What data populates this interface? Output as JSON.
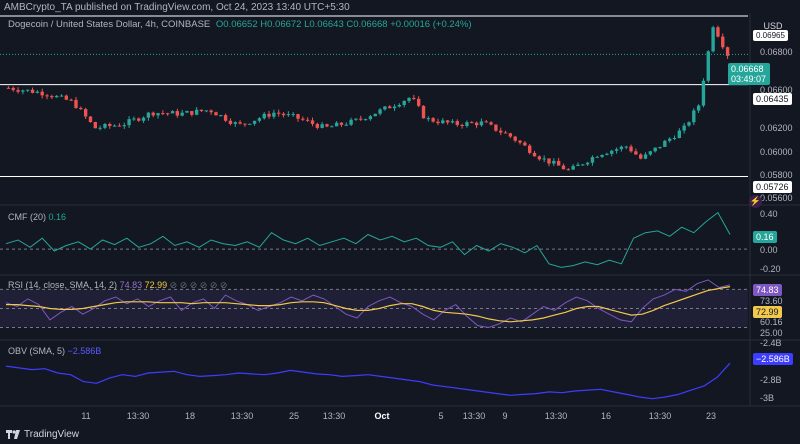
{
  "header": {
    "publisher": "AMBCrypto_TA published on TradingView.com, Oct 24, 2023 13:40 UTC+5:30",
    "symbol": "Dogecoin / United States Dollar, 4h, COINBASE",
    "ohlc": "O0.06652 H0.06672 L0.06643 C0.06668 +0.00016 (+0.24%)",
    "currency": "USD"
  },
  "labels": {
    "cmf": "CMF (20)",
    "cmf_value": "0.16",
    "rsi": "RSI (14, close, SMA, 14, 2)",
    "rsi_value": "74.83",
    "rsi_ma_value": "72.99",
    "rsi_dots": "⊘ ⊘ ⊘ ⊘ ⊘ ⊘",
    "obv": "OBV (SMA, 5)",
    "obv_value": "−2.586B",
    "brand": "TradingView"
  },
  "price_tags": {
    "current": "0.06668",
    "countdown": "03:49:07",
    "resistance": "0.06435",
    "support": "0.05726",
    "top_cut": "0.06965"
  },
  "colors": {
    "background": "#131722",
    "up": "#26a69a",
    "down": "#ef5350",
    "cmf": "#26a69a",
    "rsi": "#7e57c2",
    "rsi_ma": "#f2c94c",
    "obv": "#3d3dff",
    "level_line": "#ffffff"
  },
  "chart_data": [
    {
      "type": "candlestick",
      "title": "Dogecoin / United States Dollar, 4h, COINBASE",
      "y_ticks": [
        "0.06800",
        "0.06600",
        "0.06400",
        "0.06200",
        "0.06000",
        "0.05800",
        "0.05600"
      ],
      "ylim": [
        0.0556,
        0.0698
      ],
      "horizontal_levels": [
        0.06435,
        0.05726,
        0.06965
      ],
      "x_ticks": [
        "11",
        "13:30",
        "18",
        "13:30",
        "25",
        "13:30",
        "Oct",
        "5",
        "13:30",
        "9",
        "13:30",
        "16",
        "13:30",
        "23"
      ],
      "close_path_estimate": [
        {
          "x": 0.0,
          "close": 0.0641
        },
        {
          "x": 0.05,
          "close": 0.0637
        },
        {
          "x": 0.09,
          "close": 0.063
        },
        {
          "x": 0.12,
          "close": 0.061
        },
        {
          "x": 0.16,
          "close": 0.0613
        },
        {
          "x": 0.2,
          "close": 0.0622
        },
        {
          "x": 0.24,
          "close": 0.0621
        },
        {
          "x": 0.28,
          "close": 0.0624
        },
        {
          "x": 0.32,
          "close": 0.0612
        },
        {
          "x": 0.37,
          "close": 0.0622
        },
        {
          "x": 0.4,
          "close": 0.0618
        },
        {
          "x": 0.44,
          "close": 0.061
        },
        {
          "x": 0.48,
          "close": 0.0615
        },
        {
          "x": 0.52,
          "close": 0.0624
        },
        {
          "x": 0.56,
          "close": 0.0634
        },
        {
          "x": 0.58,
          "close": 0.0617
        },
        {
          "x": 0.62,
          "close": 0.0613
        },
        {
          "x": 0.66,
          "close": 0.0614
        },
        {
          "x": 0.7,
          "close": 0.0603
        },
        {
          "x": 0.74,
          "close": 0.0587
        },
        {
          "x": 0.78,
          "close": 0.0577
        },
        {
          "x": 0.82,
          "close": 0.059
        },
        {
          "x": 0.86,
          "close": 0.0596
        },
        {
          "x": 0.88,
          "close": 0.0586
        },
        {
          "x": 0.91,
          "close": 0.0598
        },
        {
          "x": 0.94,
          "close": 0.061
        },
        {
          "x": 0.96,
          "close": 0.0628
        },
        {
          "x": 0.98,
          "close": 0.069
        },
        {
          "x": 1.0,
          "close": 0.06668
        }
      ]
    },
    {
      "type": "line",
      "title": "CMF (20)",
      "y_ticks": [
        "0.40",
        "0.20",
        "0.00",
        "-0.20"
      ],
      "ylim": [
        -0.25,
        0.45
      ],
      "series": [
        {
          "name": "CMF",
          "values": [
            0.06,
            0.1,
            0.02,
            0.12,
            -0.02,
            0.04,
            0.08,
            0.0,
            0.1,
            0.05,
            0.12,
            0.02,
            0.06,
            0.14,
            0.04,
            0.08,
            0.02,
            0.1,
            0.06,
            0.04,
            0.08,
            0.02,
            0.18,
            0.1,
            0.06,
            0.12,
            0.04,
            0.08,
            0.12,
            0.06,
            0.16,
            0.1,
            0.14,
            0.08,
            0.12,
            0.04,
            0.02,
            0.08,
            -0.06,
            0.04,
            -0.02,
            0.06,
            0.02,
            -0.04,
            0.04,
            -0.16,
            -0.2,
            -0.18,
            -0.14,
            -0.17,
            -0.12,
            -0.16,
            0.12,
            0.18,
            0.2,
            0.14,
            0.24,
            0.18,
            0.3,
            0.4,
            0.16
          ]
        }
      ]
    },
    {
      "type": "line",
      "title": "RSI (14, close, SMA, 14, 2)",
      "y_ticks": [
        "73.60",
        "60.16",
        "25.00"
      ],
      "ylim": [
        20,
        82
      ],
      "series": [
        {
          "name": "RSI",
          "values": [
            56,
            52,
            60,
            54,
            38,
            46,
            52,
            44,
            50,
            58,
            62,
            55,
            60,
            52,
            58,
            62,
            48,
            56,
            60,
            50,
            64,
            58,
            54,
            48,
            52,
            56,
            62,
            58,
            64,
            60,
            52,
            44,
            40,
            52,
            58,
            62,
            56,
            52,
            44,
            38,
            48,
            54,
            42,
            32,
            30,
            34,
            40,
            36,
            44,
            52,
            48,
            56,
            62,
            58,
            50,
            44,
            38,
            36,
            50,
            60,
            64,
            70,
            68,
            76,
            80,
            72,
            74.83
          ]
        },
        {
          "name": "RSI-based MA",
          "values": [
            54,
            54,
            53,
            52,
            50,
            49,
            49,
            50,
            52,
            54,
            56,
            57,
            57,
            57,
            56,
            56,
            56,
            55,
            56,
            56,
            56,
            55,
            54,
            53,
            53,
            54,
            56,
            57,
            57,
            56,
            53,
            50,
            48,
            48,
            50,
            53,
            55,
            55,
            52,
            48,
            46,
            45,
            44,
            42,
            39,
            37,
            36,
            37,
            38,
            40,
            43,
            46,
            50,
            52,
            52,
            49,
            46,
            43,
            44,
            48,
            53,
            57,
            61,
            65,
            69,
            71,
            72.99
          ]
        }
      ]
    },
    {
      "type": "line",
      "title": "OBV (SMA, 5)",
      "y_ticks": [
        "-2.4B",
        "-2.8B",
        "-3B"
      ],
      "ylim": [
        -3.05,
        -2.35
      ],
      "series": [
        {
          "name": "OBV",
          "values": [
            -2.62,
            -2.64,
            -2.66,
            -2.65,
            -2.7,
            -2.72,
            -2.8,
            -2.82,
            -2.76,
            -2.72,
            -2.74,
            -2.7,
            -2.69,
            -2.68,
            -2.72,
            -2.74,
            -2.73,
            -2.72,
            -2.7,
            -2.71,
            -2.72,
            -2.7,
            -2.67,
            -2.69,
            -2.71,
            -2.72,
            -2.74,
            -2.73,
            -2.72,
            -2.74,
            -2.76,
            -2.78,
            -2.8,
            -2.84,
            -2.86,
            -2.88,
            -2.9,
            -2.92,
            -2.94,
            -2.96,
            -2.95,
            -2.94,
            -2.92,
            -2.93,
            -2.91,
            -2.9,
            -2.89,
            -2.92,
            -2.95,
            -2.98,
            -3.0,
            -2.98,
            -2.95,
            -2.9,
            -2.85,
            -2.75,
            -2.586
          ]
        }
      ]
    }
  ]
}
